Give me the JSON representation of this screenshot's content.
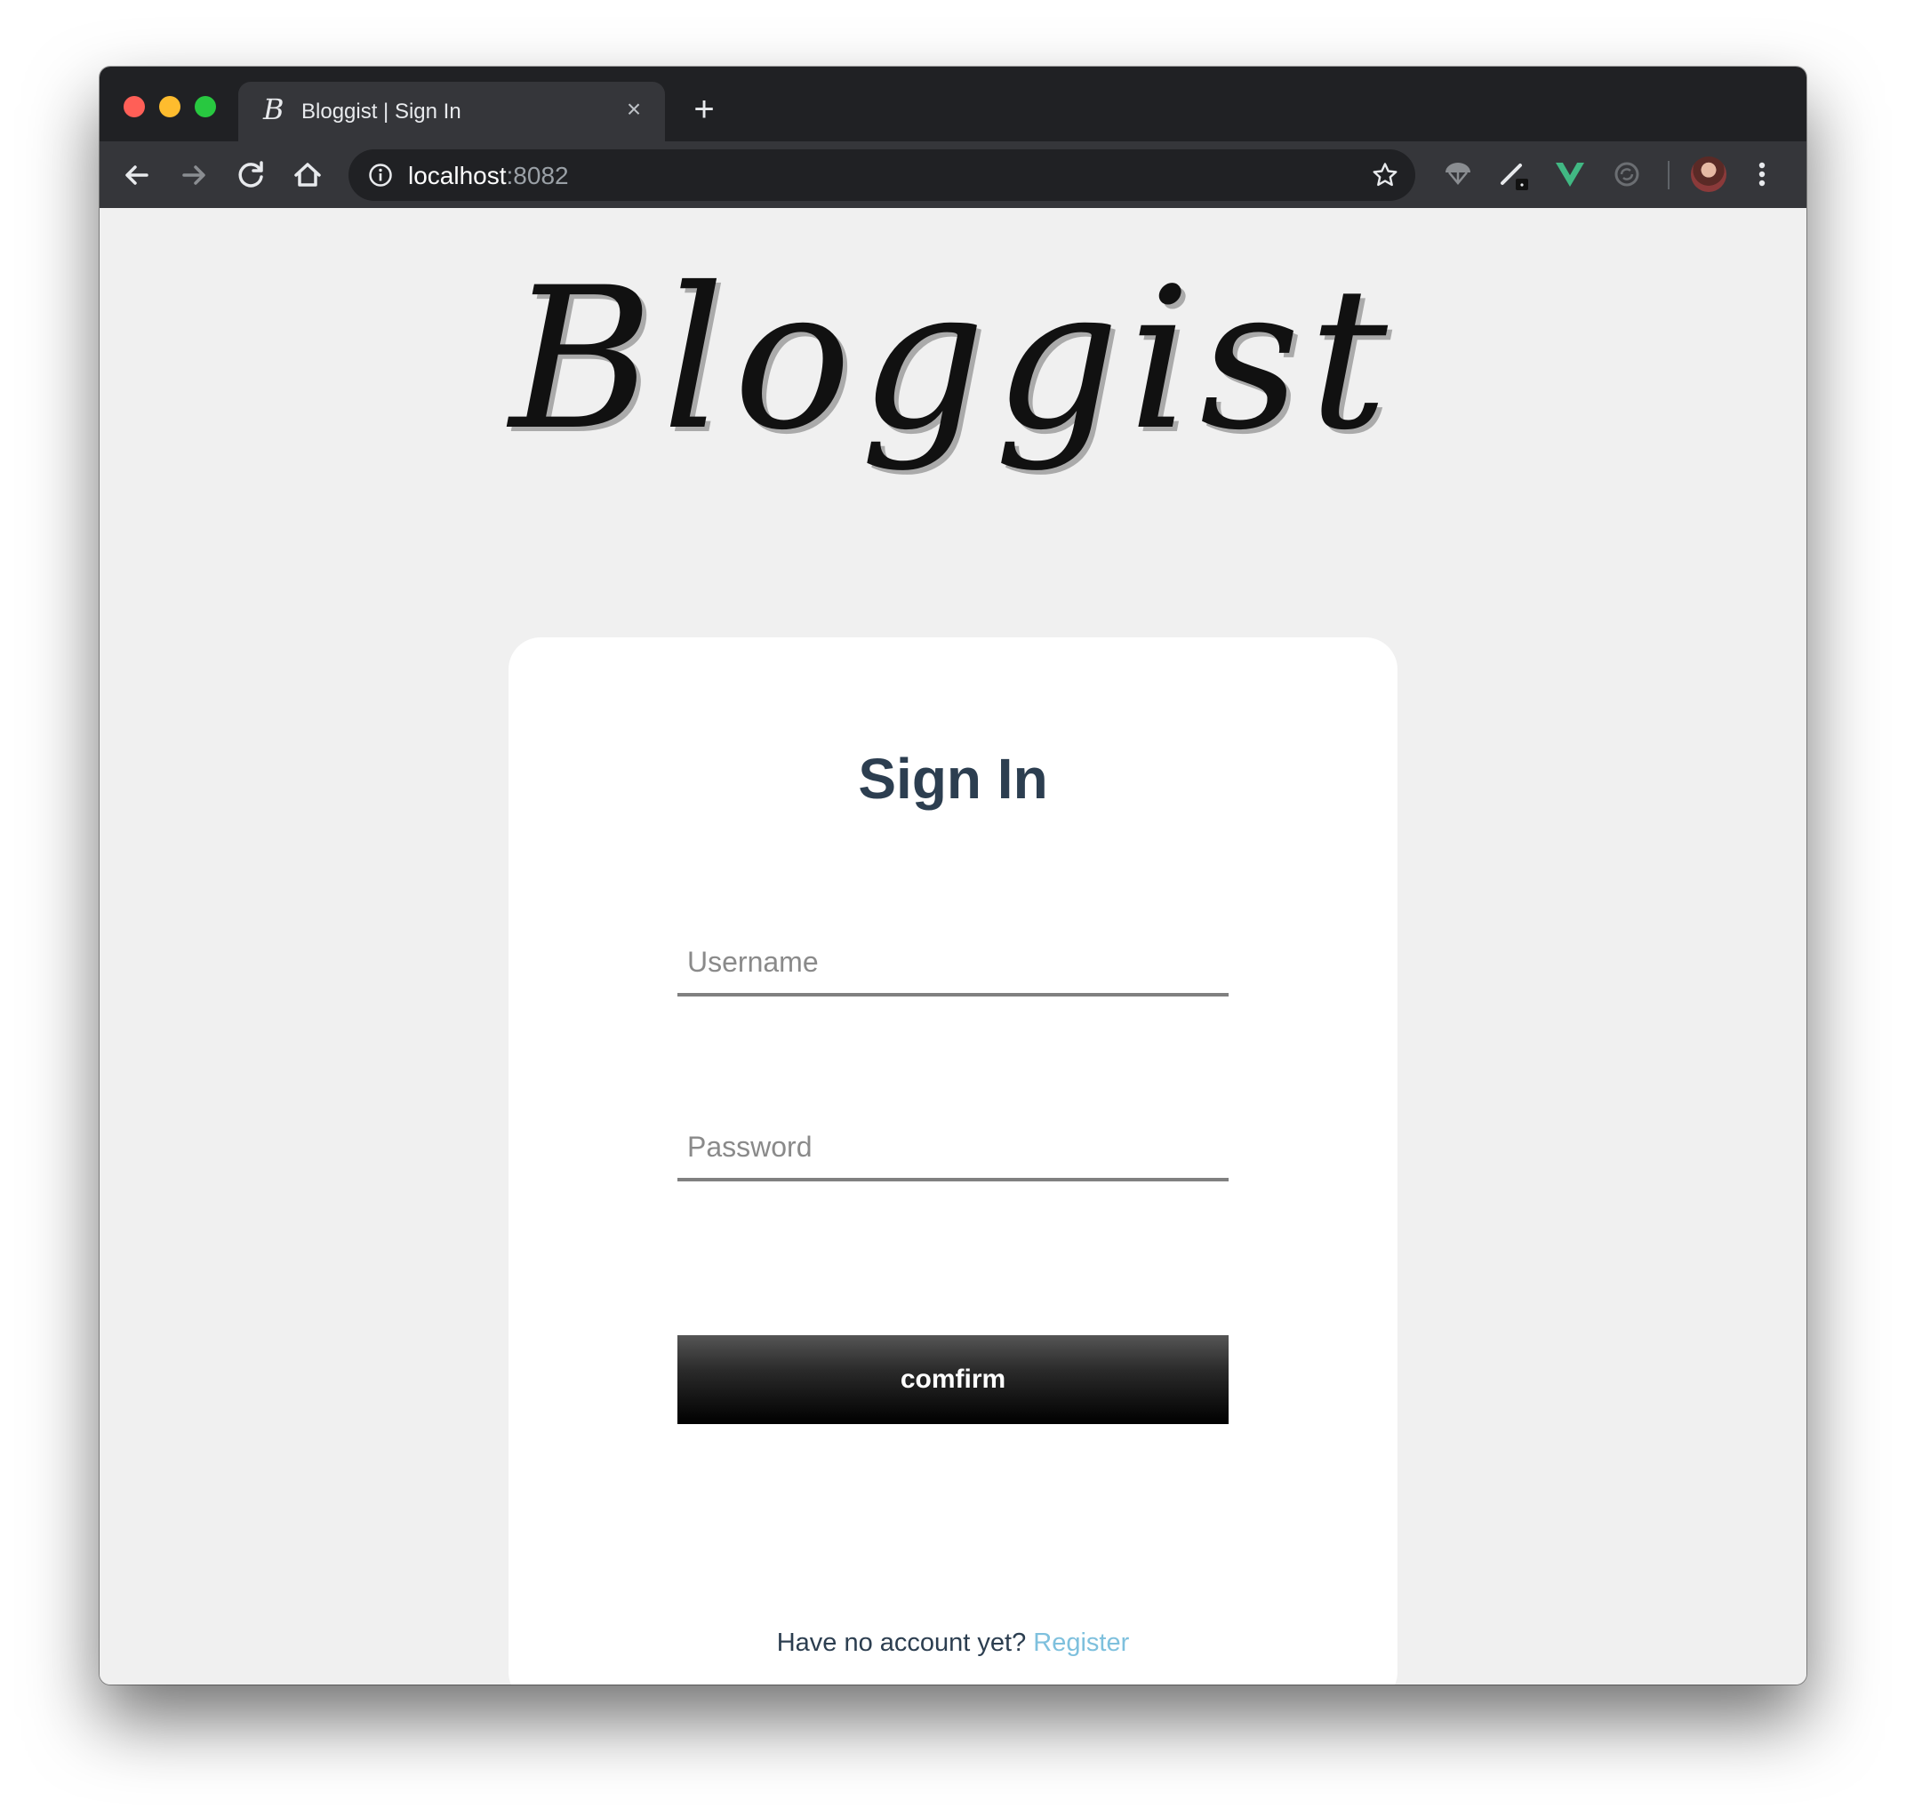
{
  "browser": {
    "tab_favicon": "B",
    "tab_title": "Bloggist | Sign In",
    "tab_close": "×",
    "new_tab": "+",
    "url_host": "localhost",
    "url_port": ":8082",
    "icons": [
      "back-arrow-icon",
      "forward-arrow-icon",
      "reload-icon",
      "home-icon",
      "info-icon",
      "star-icon",
      "extension-parachute-icon",
      "extension-pen-icon",
      "vue-devtools-icon",
      "extension-sync-icon",
      "profile-avatar",
      "kebab-menu-icon"
    ]
  },
  "page": {
    "logo": "Bloggist",
    "card": {
      "title": "Sign In",
      "username_placeholder": "Username",
      "password_placeholder": "Password",
      "confirm_label": "comfirm",
      "footer_text": "Have no account yet?",
      "register_link": "Register"
    }
  },
  "colors": {
    "page_background": "#f0f0f0",
    "title_color": "#2c3e50",
    "link_color": "#7ec0dd",
    "button_dark": "#000000"
  }
}
